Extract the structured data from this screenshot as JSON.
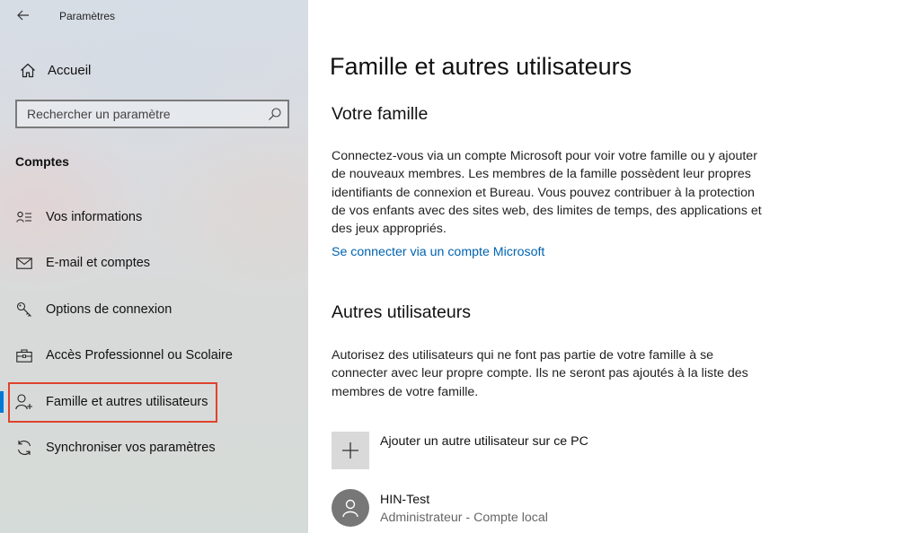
{
  "window": {
    "title": "Paramètres"
  },
  "sidebar": {
    "home_label": "Accueil",
    "search": {
      "placeholder": "Rechercher un paramètre"
    },
    "section_title": "Comptes",
    "items": [
      {
        "label": "Vos informations",
        "icon": "user-info-icon"
      },
      {
        "label": "E-mail et comptes",
        "icon": "mail-icon"
      },
      {
        "label": "Options de connexion",
        "icon": "key-icon"
      },
      {
        "label": "Accès Professionnel ou Scolaire",
        "icon": "briefcase-icon"
      },
      {
        "label": "Famille et autres utilisateurs",
        "icon": "add-person-icon",
        "selected": true
      },
      {
        "label": "Synchroniser vos paramètres",
        "icon": "sync-icon"
      }
    ]
  },
  "main": {
    "title": "Famille et autres utilisateurs",
    "family": {
      "heading": "Votre famille",
      "description": "Connectez-vous via un compte Microsoft pour voir votre famille ou y ajouter de nouveaux membres. Les membres de la famille possèdent leur propres identifiants de connexion et Bureau. Vous pouvez contribuer à la protection de vos enfants avec des sites web, des limites de temps, des applications et des jeux appropriés.",
      "link": "Se connecter via un compte Microsoft"
    },
    "others": {
      "heading": "Autres utilisateurs",
      "description": "Autorisez des utilisateurs qui ne font pas partie de votre famille à se connecter avec leur propre compte. Ils ne seront pas ajoutés à la liste des membres de votre famille.",
      "add_label": "Ajouter un autre utilisateur sur ce PC",
      "users": [
        {
          "name": "HIN-Test",
          "subtitle": "Administrateur - Compte local"
        }
      ]
    }
  },
  "colors": {
    "accent": "#0078d7",
    "link": "#0063b1",
    "highlight": "#e0432d"
  }
}
